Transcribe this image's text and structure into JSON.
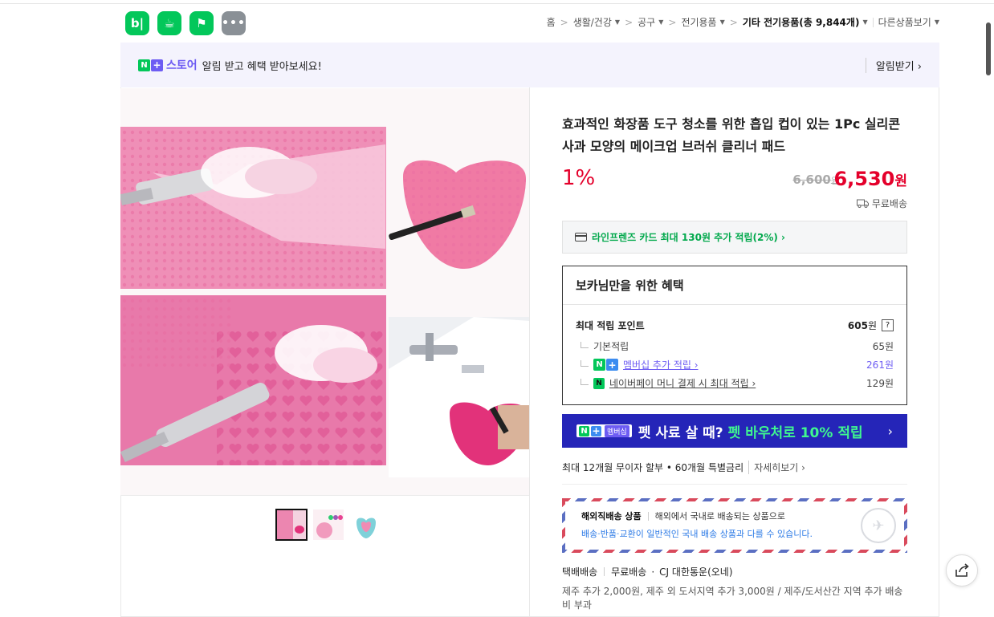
{
  "header": {
    "app_icons": [
      {
        "icon": "blog-icon",
        "glyph": "b|"
      },
      {
        "icon": "cafe-icon",
        "glyph": "☕"
      },
      {
        "icon": "clip-icon",
        "glyph": "⚑"
      },
      {
        "icon": "more-apps-icon",
        "glyph": "•••"
      }
    ],
    "breadcrumb": {
      "home": "홈",
      "level1": "생활/건강",
      "level2": "공구",
      "level3": "전기용품",
      "current_prefix": "기타 전기용품",
      "current_count": "(총 9,844개)",
      "other": "다른상품보기"
    }
  },
  "banner": {
    "n_letter": "N",
    "plus": "+",
    "store_name": "스토어",
    "message": "알림 받고 혜택 받아보세요!",
    "alarm_label": "알림받기 ›"
  },
  "product": {
    "title": "효과적인 화장품 도구 청소를 위한 흡입 컵이 있는 1Pc 실리콘 사과 모양의 메이크업 브러쉬 클리너 패드",
    "discount": "1%",
    "original_price": "6,600",
    "original_unit": "원",
    "price": "6,530",
    "price_unit": "원",
    "shipping": "무료배송"
  },
  "card_benefit": "라인프렌즈 카드 최대 130원 추가 적립(2%) ›",
  "benefits": {
    "heading": "보카님만을 위한 혜택",
    "max_points_label": "최대 적립 포인트",
    "max_points_value": "605",
    "max_points_unit": "원",
    "help": "?",
    "basic_label": "기본적립",
    "basic_value": "65원",
    "membership_label": "멤버십 추가 적립 ›",
    "membership_value": "261원",
    "npay_label": "네이버페이 머니 결제 시 최대 적립 ›",
    "npay_value": "129원"
  },
  "promo": {
    "n_letter": "N",
    "plus": "+",
    "membership": "멤버십",
    "text1": "펫 사료 살 때?",
    "text2": "펫 바우처로 10% 적립",
    "arrow": "›"
  },
  "installment": {
    "text": "최대 12개월 무이자 할부 • 60개월 특별금리",
    "more": "자세히보기 ›"
  },
  "overseas": {
    "label": "해외직배송 상품",
    "desc": "해외에서 국내로 배송되는 상품으로",
    "notice": "배송·반품·교환이 일반적인 국내 배송 상품과 다를 수 있습니다."
  },
  "delivery": {
    "method": "택배배송",
    "fee": "무료배송",
    "carrier": "CJ 대한통운(오네)",
    "extra": "제주 추가 2,000원, 제주 외 도서지역 추가 3,000원 / 제주/도서산간 지역 추가 배송비 부과"
  },
  "colors": {
    "accent_red": "#e4002b",
    "naver_green": "#03c75a",
    "store_purple": "#6d5cf3",
    "promo_blue": "#2525b8"
  }
}
